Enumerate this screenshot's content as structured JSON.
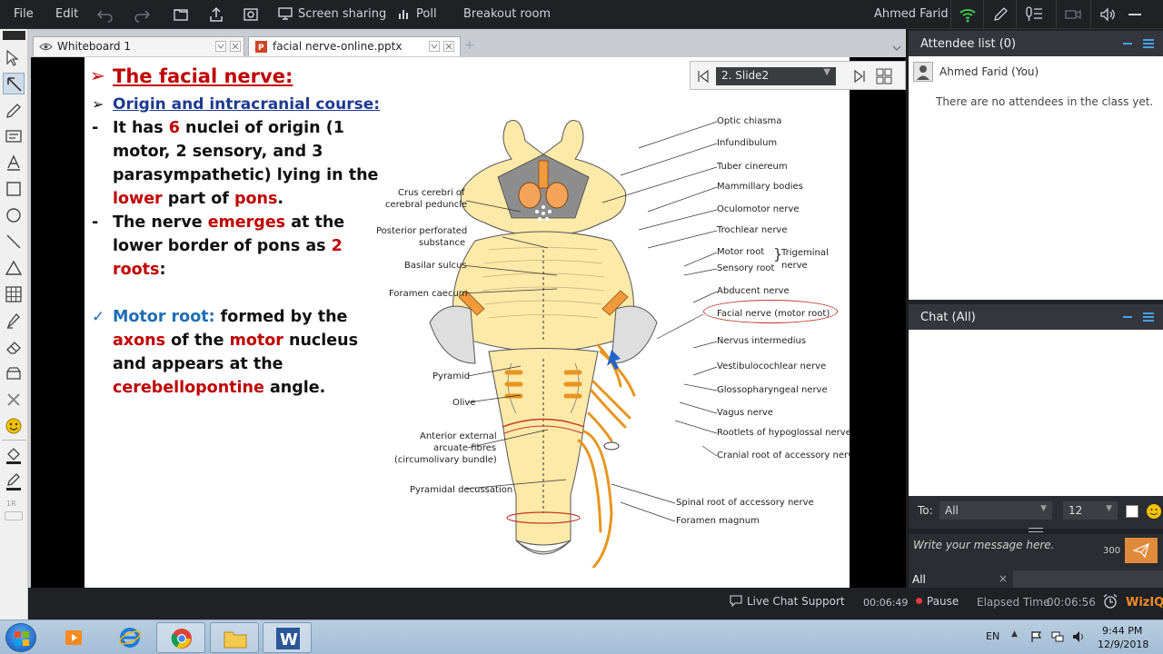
{
  "menubar": {
    "file": "File",
    "edit": "Edit",
    "screen_sharing": "Screen sharing",
    "poll": "Poll",
    "breakout_room": "Breakout room",
    "user_name": "Ahmed Farid"
  },
  "tabs": [
    {
      "label": "Whiteboard 1"
    },
    {
      "label": "facial nerve-online.pptx"
    }
  ],
  "slide_nav": {
    "current": "2. Slide2"
  },
  "slide": {
    "title": "The facial nerve:",
    "subtitle": "Origin and intracranial course:",
    "p1": {
      "l1a": "It has ",
      "l1b": "6",
      "l1c": " nuclei of origin (1",
      "l2": "motor,  2 sensory, and 3",
      "l3": "parasympathetic) lying in the",
      "l4a": "lower",
      "l4b": " part of ",
      "l4c": "pons",
      "l4d": "."
    },
    "p2": {
      "l1a": "The nerve ",
      "l1b": "emerges",
      "l1c": " at the",
      "l2a": "lower border of pons as ",
      "l2b": "2",
      "l3a": "roots",
      "l3b": ":"
    },
    "p3": {
      "l1a": "Motor root:",
      "l1b": " formed by the",
      "l2a": "axons",
      "l2b": " of the ",
      "l2c": "motor",
      "l2d": " nucleus",
      "l3": "and appears at the",
      "l4a": "cerebellopontine",
      "l4b": " angle."
    },
    "bullet_dash": "-",
    "check": "✓",
    "arrow": "➢"
  },
  "diagram_labels": {
    "left": {
      "crus1": "Crus cerebri of",
      "crus2": "cerebral peduncle",
      "post1": "Posterior perforated",
      "post2": "substance",
      "basilar": "Basilar sulcus",
      "foramen_caecum": "Foramen caecum",
      "pyramid": "Pyramid",
      "olive": "Olive",
      "ant1": "Anterior external",
      "ant2": "arcuate fibres",
      "ant3": "(circumolivary bundle)",
      "pyr_dec": "Pyramidal decussation"
    },
    "right": {
      "optic": "Optic chiasma",
      "infund": "Infundibulum",
      "tuber": "Tuber cinereum",
      "mammillary": "Mammillary bodies",
      "oculomotor": "Oculomotor nerve",
      "trochlear": "Trochlear nerve",
      "motor_root": "Motor root",
      "sensory_root": "Sensory root",
      "trigeminal1": "Trigeminal",
      "trigeminal2": "nerve",
      "abducent": "Abducent nerve",
      "facial": "Facial nerve (motor root)",
      "intermedius": "Nervus intermedius",
      "vestibulo": "Vestibulocochlear nerve",
      "glosso": "Glossopharyngeal nerve",
      "vagus": "Vagus nerve",
      "hypoglossal": "Rootlets of hypoglossal nerve",
      "cranial_acc": "Cranial root of accessory nerve",
      "spinal_acc": "Spinal root of accessory nerve",
      "foramen_magnum": "Foramen magnum"
    }
  },
  "attendee_panel": {
    "title": "Attendee list (0)",
    "you": "Ahmed Farid (You)",
    "empty": "There are no attendees in the class yet."
  },
  "chat_panel": {
    "title": "Chat (All)",
    "to_label": "To:",
    "to_value": "All",
    "font_size": "12",
    "placeholder": "Write your message here.",
    "char_count": "300",
    "filter_tab": "All"
  },
  "status": {
    "live_chat": "Live Chat Support",
    "session_time": "00:06:49",
    "pause": "Pause",
    "elapsed_label": "Elapsed Time",
    "elapsed_value": "00:06:56",
    "brand": "WizIQ"
  },
  "taskbar": {
    "lang": "EN",
    "time": "9:44 PM",
    "date": "12/9/2018"
  },
  "colors": {
    "accent_blue": "#4aa0e8",
    "slide_red": "#c00000",
    "slide_blue": "#1f6fb4",
    "nerve_orange": "#e8951f"
  }
}
